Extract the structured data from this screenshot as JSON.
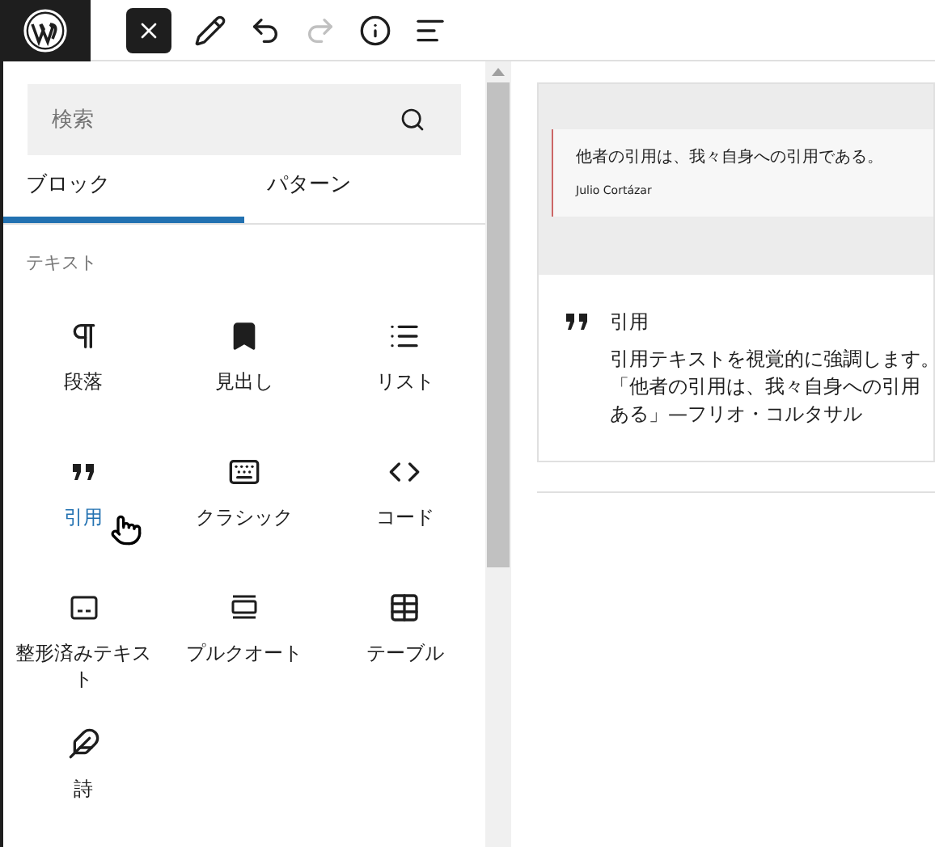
{
  "toolbar": [
    {
      "kind": "close",
      "disabled": false
    },
    {
      "kind": "pencil",
      "disabled": false
    },
    {
      "kind": "undo",
      "disabled": false
    },
    {
      "kind": "redo",
      "disabled": true
    },
    {
      "kind": "info",
      "disabled": false
    },
    {
      "kind": "outline",
      "disabled": false
    }
  ],
  "search": {
    "placeholder": "検索"
  },
  "tabs": [
    {
      "label": "ブロック",
      "selected": true
    },
    {
      "label": "パターン",
      "selected": false
    }
  ],
  "section": "テキスト",
  "blocks": [
    {
      "kind": "paragraph",
      "label": "段落",
      "highlighted": false
    },
    {
      "kind": "heading",
      "label": "見出し",
      "highlighted": false
    },
    {
      "kind": "list",
      "label": "リスト",
      "highlighted": false
    },
    {
      "kind": "quote",
      "label": "引用",
      "highlighted": true
    },
    {
      "kind": "classic",
      "label": "クラシック",
      "highlighted": false
    },
    {
      "kind": "code",
      "label": "コード",
      "highlighted": false
    },
    {
      "kind": "preformatted",
      "label": "整形済みテキスト",
      "highlighted": false
    },
    {
      "kind": "pullquote",
      "label": "プルクオート",
      "highlighted": false
    },
    {
      "kind": "table",
      "label": "テーブル",
      "highlighted": false
    },
    {
      "kind": "verse",
      "label": "詩",
      "highlighted": false
    }
  ],
  "preview": {
    "quote": "他者の引用は、我々自身への引用である。",
    "citation": "Julio Cortázar",
    "title": "引用",
    "description": [
      "引用テキストを視覚的に強調します。",
      "「他者の引用は、我々自身への引用",
      "ある」—フリオ・コルタサル"
    ]
  }
}
